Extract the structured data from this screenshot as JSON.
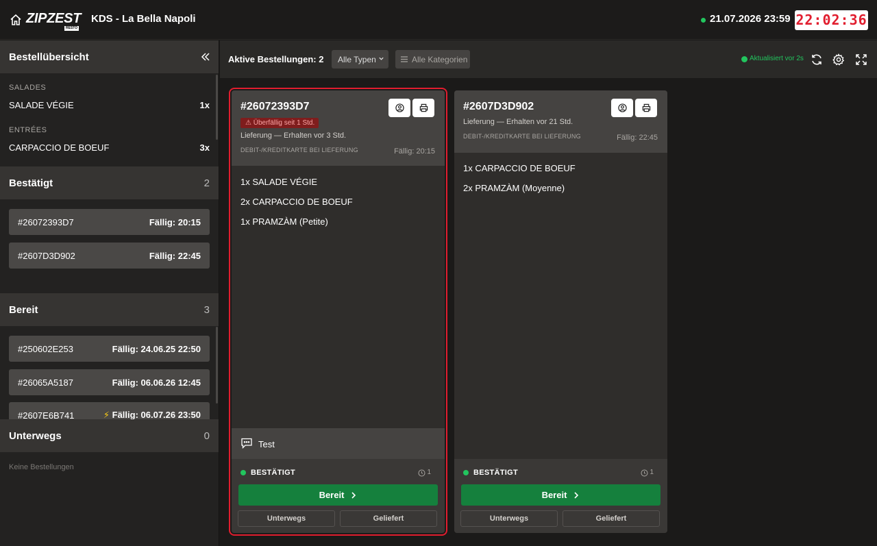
{
  "header": {
    "logo_text": "ZIPZEST",
    "logo_sub": "RESTO",
    "title": "KDS - La Bella Napoli",
    "datetime": "21.07.2026 23:59",
    "clock": "22:02:36"
  },
  "sidebar": {
    "title": "Bestellübersicht",
    "categories": [
      {
        "label": "SALADES",
        "items": [
          {
            "name": "SALADE VÉGIE",
            "qty": "1x"
          }
        ]
      },
      {
        "label": "ENTRÉES",
        "items": [
          {
            "name": "CARPACCIO DE BOEUF",
            "qty": "3x"
          }
        ]
      }
    ],
    "sections": [
      {
        "title": "Bestätigt",
        "count": "2",
        "orders": [
          {
            "id": "#26072393D7",
            "due": "Fällig: 20:15"
          },
          {
            "id": "#2607D3D902",
            "due": "Fällig: 22:45"
          }
        ]
      },
      {
        "title": "Bereit",
        "count": "3",
        "orders": [
          {
            "id": "#250602E253",
            "due": "Fällig: 24.06.25 22:50"
          },
          {
            "id": "#26065A5187",
            "due": "Fällig: 06.06.26 12:45"
          },
          {
            "id": "#2607E6B741",
            "due": "Fällig: 06.07.26 23:50"
          }
        ]
      },
      {
        "title": "Unterwegs",
        "count": "0",
        "empty": "Keine Bestellungen"
      }
    ]
  },
  "toolbar": {
    "active_label": "Aktive Bestellungen: 2",
    "type_select": "Alle Typen",
    "category_button": "Alle Kategorien",
    "updated": "Aktualisiert vor 2s"
  },
  "orders": [
    {
      "id": "#26072393D7",
      "overdue_badge": "Überfällig seit 1 Std.",
      "delivery": "Lieferung — Erhalten vor 3 Std.",
      "payment": "DEBIT-/KREDITKARTE BEI LIEFERUNG",
      "due": "Fällig: 20:15",
      "items": [
        "1x SALADE VÉGIE",
        "2x CARPACCIO DE BOEUF",
        "1x PRAMZÀM (Petite)"
      ],
      "note": "Test",
      "status": "BESTÄTIGT",
      "status_count": "1",
      "ready_label": "Bereit",
      "btn_enroute": "Unterwegs",
      "btn_delivered": "Geliefert"
    },
    {
      "id": "#2607D3D902",
      "delivery": "Lieferung — Erhalten vor 21 Std.",
      "payment": "DEBIT-/KREDITKARTE BEI LIEFERUNG",
      "due": "Fällig: 22:45",
      "items": [
        "1x CARPACCIO DE BOEUF",
        "2x PRAMZÀM (Moyenne)"
      ],
      "status": "BESTÄTIGT",
      "status_count": "1",
      "ready_label": "Bereit",
      "btn_enroute": "Unterwegs",
      "btn_delivered": "Geliefert"
    }
  ],
  "colors": {
    "accent_green": "#15803d",
    "status_green": "#22c55e",
    "alert_red": "#e11d2e"
  }
}
